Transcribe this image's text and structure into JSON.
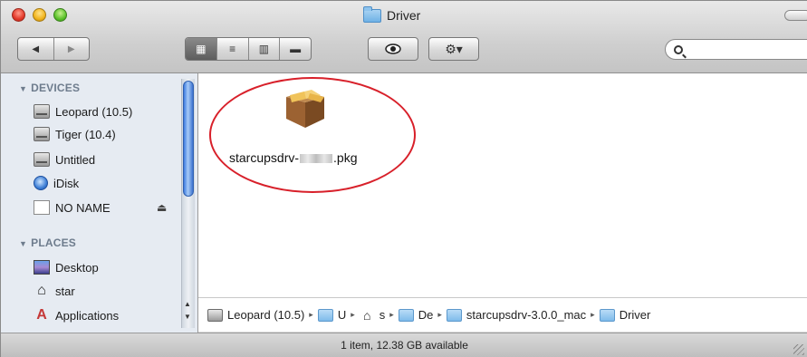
{
  "window": {
    "title": "Driver",
    "folder_icon": "folder-icon"
  },
  "toolbar": {
    "back_icon": "◀",
    "forward_icon": "▶",
    "view_icons": [
      "▦",
      "≡",
      "▥",
      "▬"
    ],
    "quicklook_icon": "👁",
    "action_icon": "⚙▾",
    "search": {
      "value": "",
      "placeholder": ""
    }
  },
  "sidebar": {
    "devices_header": "DEVICES",
    "places_header": "PLACES",
    "devices": [
      {
        "label": "Leopard (10.5)",
        "icon": "hard-drive-icon"
      },
      {
        "label": "Tiger (10.4)",
        "icon": "hard-drive-icon"
      },
      {
        "label": "Untitled",
        "icon": "hard-drive-icon"
      },
      {
        "label": "iDisk",
        "icon": "idisk-icon"
      },
      {
        "label": "NO NAME",
        "icon": "removable-disk-icon"
      }
    ],
    "eject_icon": "⏏",
    "places": [
      {
        "label": "Desktop",
        "icon": "desktop-icon"
      },
      {
        "label": "star",
        "icon": "home-icon"
      },
      {
        "label": "Applications",
        "icon": "applications-icon"
      }
    ]
  },
  "main": {
    "file": {
      "name_prefix": "starcupsdrv-",
      "name_suffix": ".pkg",
      "icon": "package-icon"
    }
  },
  "pathbar": {
    "items": [
      {
        "label": "Leopard (10.5)",
        "icon": "hard-drive-icon"
      },
      {
        "label": "U",
        "icon": "folder-icon"
      },
      {
        "label": "s",
        "icon": "home-icon"
      },
      {
        "label": "De",
        "icon": "folder-icon"
      },
      {
        "label": "starcupsdrv-3.0.0_mac",
        "icon": "folder-icon"
      },
      {
        "label": "Driver",
        "icon": "folder-icon"
      }
    ],
    "separator": "▸"
  },
  "status": {
    "text": "1 item, 12.38 GB available"
  },
  "colors": {
    "sidebar_bg": "#e6ebf2",
    "highlight_ellipse": "#d8202a",
    "selected_view": "#5d5d5d"
  }
}
